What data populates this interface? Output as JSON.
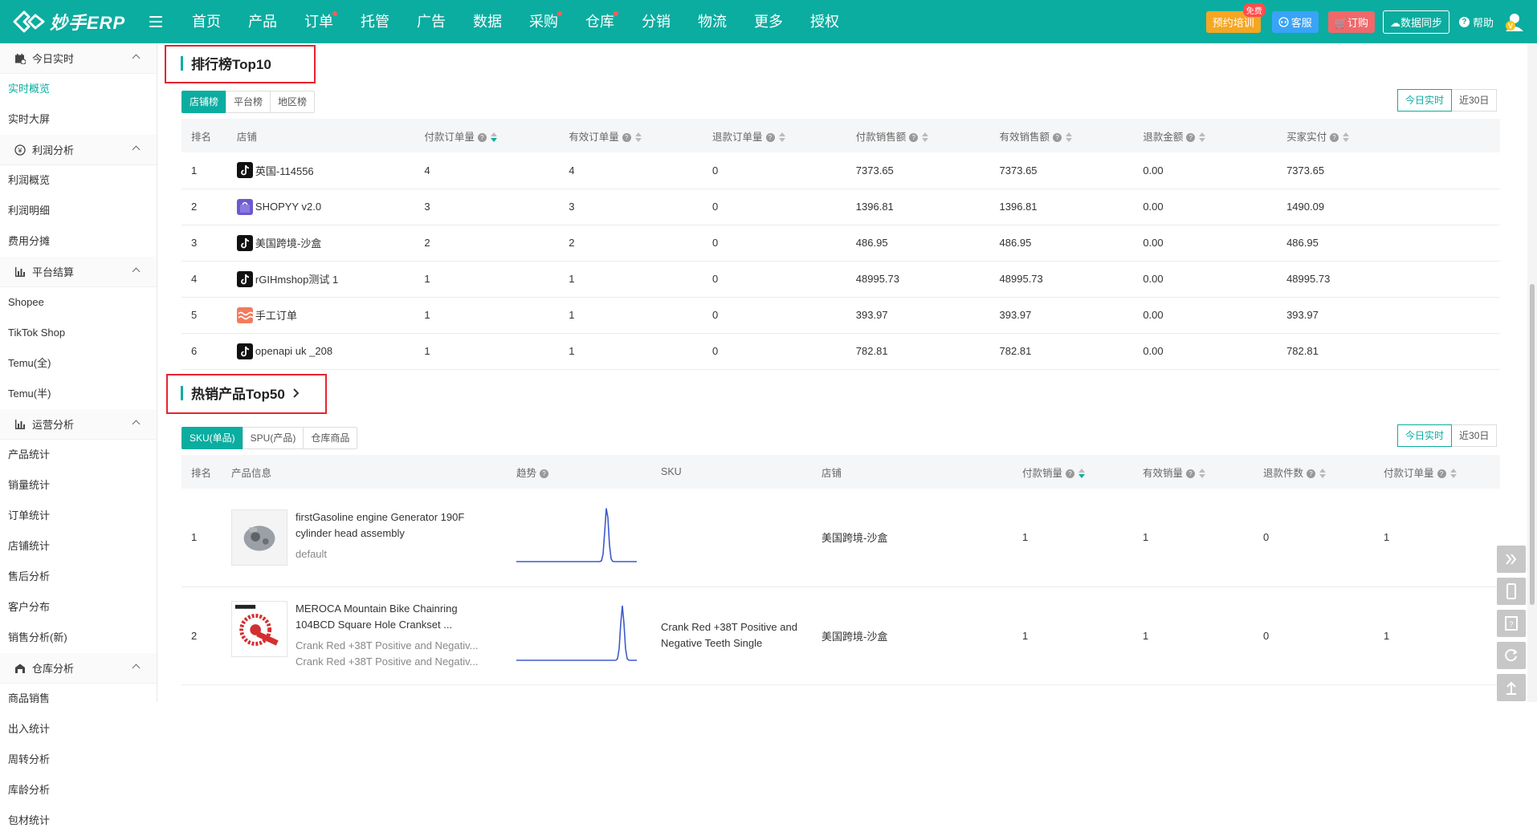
{
  "brand": {
    "name": "妙手ERP"
  },
  "nav": {
    "items": [
      {
        "label": "首页",
        "dot": false
      },
      {
        "label": "产品",
        "dot": false
      },
      {
        "label": "订单",
        "dot": true
      },
      {
        "label": "托管",
        "dot": false
      },
      {
        "label": "广告",
        "dot": false
      },
      {
        "label": "数据",
        "dot": false
      },
      {
        "label": "采购",
        "dot": true
      },
      {
        "label": "仓库",
        "dot": true
      },
      {
        "label": "分销",
        "dot": false
      },
      {
        "label": "物流",
        "dot": false
      },
      {
        "label": "更多",
        "dot": false
      },
      {
        "label": "授权",
        "dot": false
      }
    ],
    "train_label": "预约培训",
    "free_badge": "免费",
    "service_label": "客服",
    "order_label": "订购",
    "sync_label": "数据同步",
    "help_label": "帮助"
  },
  "sidebar": {
    "groups": [
      {
        "title": "今日实时",
        "icon": "calendar-icon",
        "items": [
          "实时概览",
          "实时大屏"
        ]
      },
      {
        "title": "利润分析",
        "icon": "money-icon",
        "items": [
          "利润概览",
          "利润明细",
          "费用分摊"
        ]
      },
      {
        "title": "平台结算",
        "icon": "bar-chart-icon",
        "items": [
          "Shopee",
          "TikTok Shop",
          "Temu(全)",
          "Temu(半)"
        ]
      },
      {
        "title": "运营分析",
        "icon": "bar-chart-icon",
        "items": [
          "产品统计",
          "销量统计",
          "订单统计",
          "店铺统计",
          "售后分析",
          "客户分布",
          "销售分析(新)"
        ]
      },
      {
        "title": "仓库分析",
        "icon": "warehouse-icon",
        "items": [
          "商品销售",
          "出入统计",
          "周转分析",
          "库龄分析",
          "包材统计"
        ]
      }
    ],
    "active": "实时概览"
  },
  "ranking": {
    "title": "排行榜Top10",
    "tabs": [
      "店铺榜",
      "平台榜",
      "地区榜"
    ],
    "active_tab": "店铺榜",
    "ranges": [
      "今日实时",
      "近30日"
    ],
    "active_range": "今日实时",
    "columns": [
      "排名",
      "店铺",
      "付款订单量",
      "有效订单量",
      "退款订单量",
      "付款销售额",
      "有效销售额",
      "退款金额",
      "买家实付"
    ],
    "rows": [
      {
        "rank": "1",
        "shop": "英国-114556",
        "icon": "tiktok",
        "paid_orders": "4",
        "valid_orders": "4",
        "refund_orders": "0",
        "paid_sales": "7373.65",
        "valid_sales": "7373.65",
        "refund_amount": "0.00",
        "buyer_paid": "7373.65"
      },
      {
        "rank": "2",
        "shop": "SHOPYY v2.0",
        "icon": "shopyy",
        "paid_orders": "3",
        "valid_orders": "3",
        "refund_orders": "0",
        "paid_sales": "1396.81",
        "valid_sales": "1396.81",
        "refund_amount": "0.00",
        "buyer_paid": "1490.09"
      },
      {
        "rank": "3",
        "shop": "美国跨境-沙盒",
        "icon": "tiktok",
        "paid_orders": "2",
        "valid_orders": "2",
        "refund_orders": "0",
        "paid_sales": "486.95",
        "valid_sales": "486.95",
        "refund_amount": "0.00",
        "buyer_paid": "486.95"
      },
      {
        "rank": "4",
        "shop": "rGIHmshop测试 1",
        "icon": "tiktok",
        "paid_orders": "1",
        "valid_orders": "1",
        "refund_orders": "0",
        "paid_sales": "48995.73",
        "valid_sales": "48995.73",
        "refund_amount": "0.00",
        "buyer_paid": "48995.73"
      },
      {
        "rank": "5",
        "shop": "手工订单",
        "icon": "manual",
        "paid_orders": "1",
        "valid_orders": "1",
        "refund_orders": "0",
        "paid_sales": "393.97",
        "valid_sales": "393.97",
        "refund_amount": "0.00",
        "buyer_paid": "393.97"
      },
      {
        "rank": "6",
        "shop": "openapi uk _208",
        "icon": "tiktok",
        "paid_orders": "1",
        "valid_orders": "1",
        "refund_orders": "0",
        "paid_sales": "782.81",
        "valid_sales": "782.81",
        "refund_amount": "0.00",
        "buyer_paid": "782.81"
      }
    ]
  },
  "hot": {
    "title": "热销产品Top50",
    "tabs": [
      "SKU(单品)",
      "SPU(产品)",
      "仓库商品"
    ],
    "active_tab": "SKU(单品)",
    "ranges": [
      "今日实时",
      "近30日"
    ],
    "active_range": "今日实时",
    "columns": [
      "排名",
      "产品信息",
      "趋势",
      "SKU",
      "店铺",
      "付款销量",
      "有效销量",
      "退款件数",
      "付款订单量"
    ],
    "rows": [
      {
        "rank": "1",
        "name": "firstGasoline engine Generator 190F cylinder head assembly",
        "variant": "default",
        "variant2": "",
        "sku": "",
        "shop": "美国跨境-沙盒",
        "paid_qty": "1",
        "valid_qty": "1",
        "refund_qty": "0",
        "paid_orders": "1",
        "trend_peak": 0.75,
        "img": "engine-part-image"
      },
      {
        "rank": "2",
        "name": "MEROCA Mountain Bike Chainring 104BCD Square Hole Crankset ...",
        "variant": "Crank Red +38T Positive and Negativ...",
        "variant2": "Crank Red +38T Positive and Negativ...",
        "sku": "Crank Red +38T Positive and Negative Teeth Single",
        "shop": "美国跨境-沙盒",
        "paid_qty": "1",
        "valid_qty": "1",
        "refund_qty": "0",
        "paid_orders": "1",
        "trend_peak": 0.88,
        "img": "bike-crank-image"
      }
    ]
  }
}
